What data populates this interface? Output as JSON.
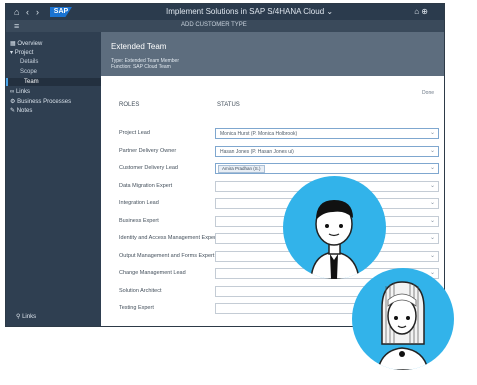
{
  "shell": {
    "title": "Implement Solutions in SAP S/4HANA Cloud",
    "title_chevron": "⌄",
    "right_icons": "⌂  ⊕",
    "logo": "SAP"
  },
  "subbar": {
    "breadcrumb": "ADD CUSTOMER TYPE"
  },
  "sidebar": {
    "items": [
      {
        "label": "Overview"
      },
      {
        "label": "Project"
      },
      {
        "label": "Details"
      },
      {
        "label": "Scope"
      },
      {
        "label": "Team"
      },
      {
        "label": "Links"
      },
      {
        "label": "Business Processes"
      },
      {
        "label": "Notes"
      }
    ],
    "bottom": "Links"
  },
  "header": {
    "title": "Extended Team",
    "line1": "Type: Extended Team Member",
    "line2": "Function: SAP Cloud Team"
  },
  "form": {
    "edit_label": "Done",
    "col_role": "ROLES",
    "col_status": "STATUS",
    "rows": [
      {
        "label": "Project Lead",
        "value": "Monica Hurst (P. Monica Holbrook)",
        "type": "text"
      },
      {
        "label": "Partner Delivery Owner",
        "value": "Hasan Jones (P. Hasan Jones ui)",
        "type": "text"
      },
      {
        "label": "Customer Delivery Lead",
        "value": "Amira Pradhan (S.)",
        "type": "chip"
      },
      {
        "label": "Data Migration Expert",
        "value": "",
        "type": "empty"
      },
      {
        "label": "Integration Lead",
        "value": "",
        "type": "empty"
      },
      {
        "label": "Business Expert",
        "value": "",
        "type": "empty"
      },
      {
        "label": "Identity and Access Management Expert",
        "value": "",
        "type": "empty"
      },
      {
        "label": "Output Management and Forms Expert",
        "value": "",
        "type": "empty"
      },
      {
        "label": "Change Management Lead",
        "value": "",
        "type": "empty"
      },
      {
        "label": "Solution Architect",
        "value": "",
        "type": "empty"
      },
      {
        "label": "Testing Expert",
        "value": "",
        "type": "empty"
      }
    ]
  },
  "colors": {
    "shell": "#2b3b4d",
    "sidebar": "#2f3f51",
    "header": "#5d6d7e",
    "avatar": "#32b3ea"
  }
}
